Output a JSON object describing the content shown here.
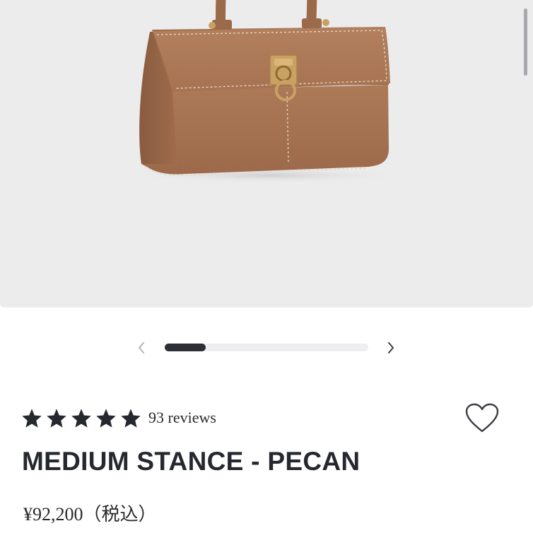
{
  "product_gallery": {
    "image_alt": "Medium Stance handbag in pecan leather",
    "image_position": 1,
    "image_count": 5,
    "prev_icon": "chevron-left-icon",
    "next_icon": "chevron-right-icon",
    "colors": {
      "background": "#ececed",
      "bag_leather": "#a87555",
      "hardware": "#c9a163",
      "progress_fill": "#2c2f36",
      "progress_track": "#eeeef0"
    }
  },
  "rating": {
    "stars": 5,
    "star_icon": "star-icon",
    "reviews_label": "93 reviews"
  },
  "wishlist": {
    "icon": "heart-outline-icon"
  },
  "product": {
    "name": "MEDIUM STANCE - PECAN",
    "price": "¥92,200（税込）"
  }
}
